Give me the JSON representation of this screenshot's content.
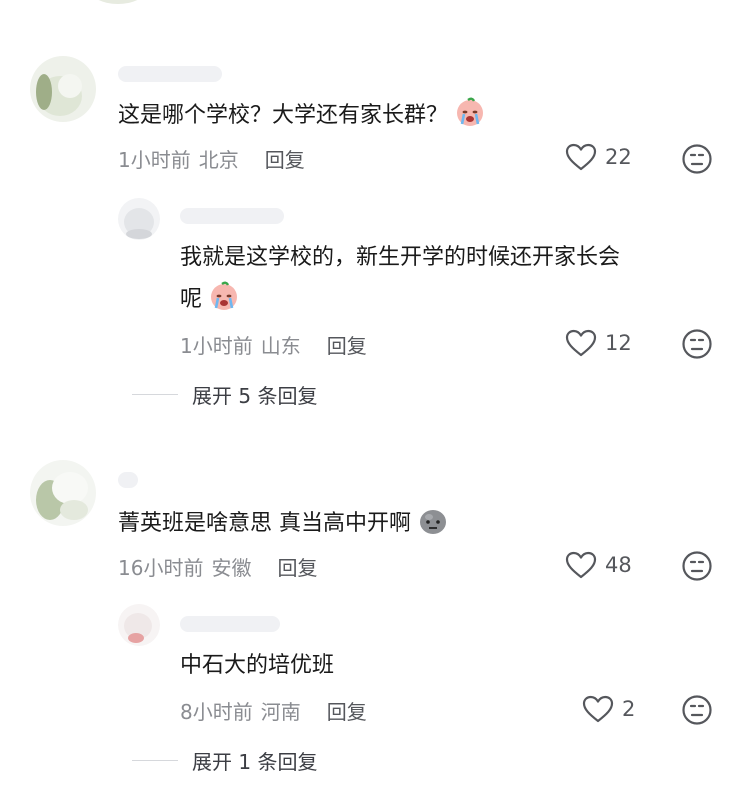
{
  "comments": [
    {
      "text": "这是哪个学校？大学还有家长群？",
      "emoji": "crying-face-emoji",
      "time": "1小时前",
      "location": "北京",
      "reply_label": "回复",
      "likes": "22",
      "replies": [
        {
          "text_line1": "我就是这学校的，新生开学的时候还开家长会",
          "text_line2": "呢",
          "emoji": "crying-face-emoji",
          "time": "1小时前",
          "location": "山东",
          "reply_label": "回复",
          "likes": "12"
        }
      ],
      "expand_label": "展开 5 条回复"
    },
    {
      "text": "菁英班是啥意思 真当高中开啊",
      "emoji": "stone-face-emoji",
      "time": "16小时前",
      "location": "安徽",
      "reply_label": "回复",
      "likes": "48",
      "replies": [
        {
          "text_line1": "中石大的培优班",
          "time": "8小时前",
          "location": "河南",
          "reply_label": "回复",
          "likes": "2"
        }
      ],
      "expand_label": "展开 1 条回复"
    }
  ],
  "colors": {
    "text": "#1a1a1a",
    "meta": "#8a8c91",
    "icon": "#55575c"
  }
}
